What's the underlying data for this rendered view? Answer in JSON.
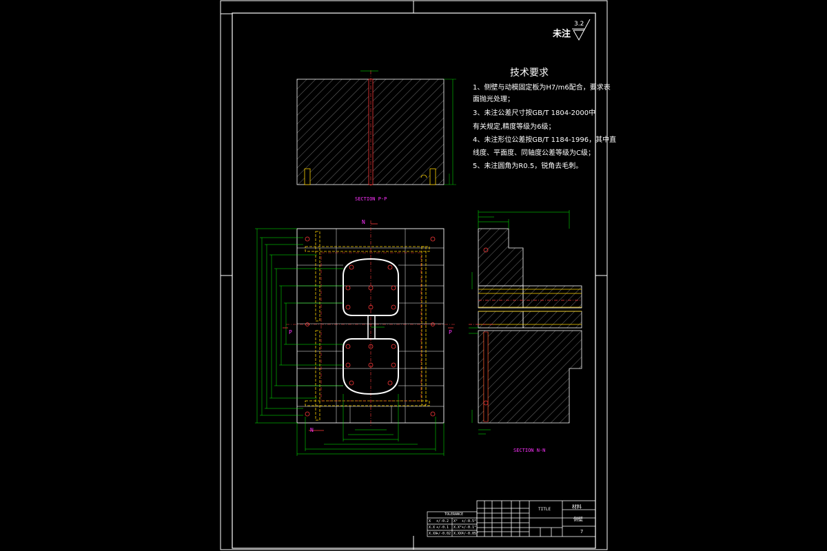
{
  "header": {
    "unmarked_label": "未注",
    "roughness_value": "3.2"
  },
  "requirements": {
    "title": "技术要求",
    "lines": [
      "1、侧壁与动模固定板为H7/m6配合，要求表",
      "   面抛光处理；",
      "3、未注公差尺寸按GB/T 1804-2000中",
      "   有关规定,精度等级为6级；",
      "4、未注形位公差按GB/T 1184-1996，其中直",
      "   线度、平面度、同轴度公差等级为C级；",
      "5、未注圆角为R0.5，锐角去毛刺。"
    ]
  },
  "sections": {
    "pp_label": "SECTION P-P",
    "nn_label": "SECTION N-N",
    "marker_n": "N",
    "marker_p": "P"
  },
  "tolerance_table": {
    "title": "TOLERANCE",
    "rows": [
      [
        "X",
        "+/-0.2",
        "X°",
        "+/-0.5°"
      ],
      [
        "X.X",
        "+/-0.1",
        "X.X°",
        "+/-0.1°"
      ],
      [
        "X.XX",
        "+/-0.02",
        "X.XX°",
        "+/-0.05°"
      ]
    ]
  },
  "title_block": {
    "ttl": "TITLE",
    "material": "材料",
    "part": "侧壁",
    "sheet": "7"
  },
  "colors": {
    "frame": "#ffffff",
    "hatch": "#9a9a9a",
    "dim": "#00ff00",
    "hidden": "#ffd400",
    "center": "#ff3a3a",
    "label": "#ff33ff"
  }
}
